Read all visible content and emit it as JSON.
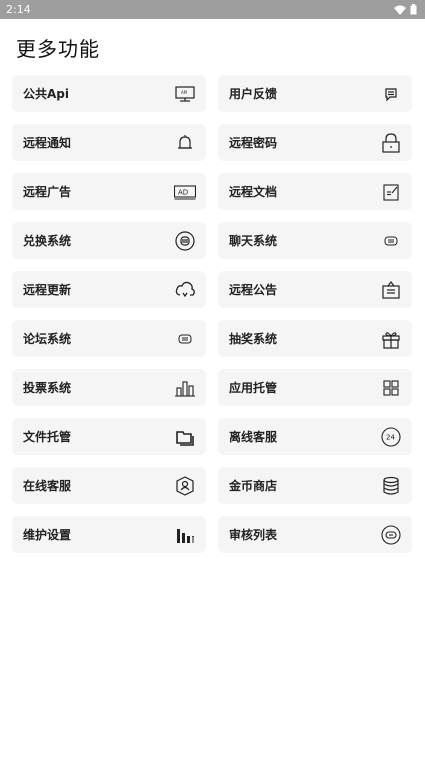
{
  "status_bar": {
    "time": "2:14",
    "wifi_icon": "wifi-icon",
    "battery_icon": "battery-icon"
  },
  "page": {
    "title": "更多功能"
  },
  "features": [
    {
      "label": "公共Api",
      "icon": "monitor-api-icon"
    },
    {
      "label": "用户反馈",
      "icon": "feedback-icon"
    },
    {
      "label": "远程通知",
      "icon": "bell-icon"
    },
    {
      "label": "远程密码",
      "icon": "lock-icon"
    },
    {
      "label": "远程广告",
      "icon": "ad-icon"
    },
    {
      "label": "远程文档",
      "icon": "document-edit-icon"
    },
    {
      "label": "兑换系统",
      "icon": "exchange-icon"
    },
    {
      "label": "聊天系统",
      "icon": "chat-icon"
    },
    {
      "label": "远程更新",
      "icon": "cloud-sync-icon"
    },
    {
      "label": "远程公告",
      "icon": "announcement-icon"
    },
    {
      "label": "论坛系统",
      "icon": "forum-icon"
    },
    {
      "label": "抽奖系统",
      "icon": "gift-icon"
    },
    {
      "label": "投票系统",
      "icon": "bar-chart-icon"
    },
    {
      "label": "应用托管",
      "icon": "apps-grid-icon"
    },
    {
      "label": "文件托管",
      "icon": "folder-icon"
    },
    {
      "label": "离线客服",
      "icon": "service-24h-icon"
    },
    {
      "label": "在线客服",
      "icon": "online-service-icon"
    },
    {
      "label": "金币商店",
      "icon": "coin-stack-icon"
    },
    {
      "label": "维护设置",
      "icon": "maintenance-bars-icon"
    },
    {
      "label": "审核列表",
      "icon": "review-icon"
    }
  ]
}
